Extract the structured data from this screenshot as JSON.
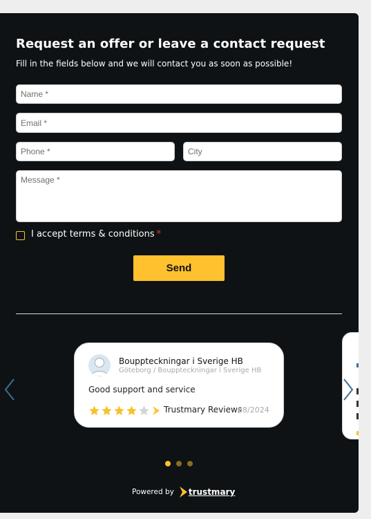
{
  "form": {
    "title": "Request an offer or leave a contact request",
    "subtitle": "Fill in the fields below and we will contact you as soon as possible!",
    "name_placeholder": "Name *",
    "email_placeholder": "Email *",
    "phone_placeholder": "Phone *",
    "city_placeholder": "City",
    "message_placeholder": "Message *",
    "terms_label": "I accept terms & conditions",
    "required_mark": "*",
    "send_label": "Send"
  },
  "review": {
    "name": "Bouppteckningar i Sverige HB",
    "location": "Göteborg / Bouppteckningar i Sverige HB",
    "text": "Good support and service",
    "rating": 4,
    "max_rating": 5,
    "source": "Trustmary Reviews",
    "date": "08/2024"
  },
  "carousel": {
    "pages": 3,
    "active_page": 0
  },
  "footer": {
    "powered_by": "Powered by",
    "brand": "trustmary"
  },
  "colors": {
    "panel_bg": "#0e1214",
    "accent": "#ffc12d",
    "arrow": "#3f6f93",
    "required": "#e53935"
  }
}
